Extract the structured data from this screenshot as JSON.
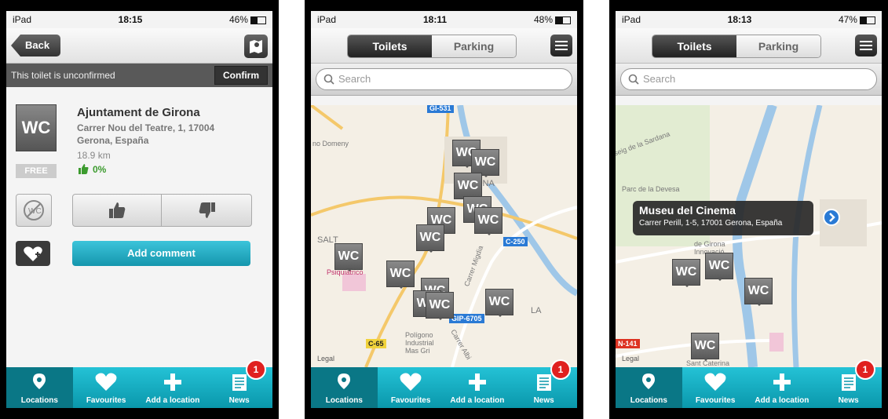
{
  "status": {
    "device": "iPad",
    "screens": [
      {
        "time": "18:15",
        "battery": "46%"
      },
      {
        "time": "18:11",
        "battery": "48%"
      },
      {
        "time": "18:13",
        "battery": "47%"
      }
    ]
  },
  "detail": {
    "back_label": "Back",
    "banner_text": "This toilet is unconfirmed",
    "confirm_label": "Confirm",
    "wc_label": "WC",
    "free_label": "FREE",
    "name": "Ajuntament de Girona",
    "address_line1": "Carrer Nou del Teatre, 1, 17004",
    "address_line2": "Gerona, España",
    "distance": "18.9 km",
    "rating": "0%",
    "add_comment_label": "Add comment"
  },
  "segment": {
    "toilets": "Toilets",
    "parking": "Parking"
  },
  "search": {
    "placeholder": "Search"
  },
  "tabs": [
    {
      "label": "Locations",
      "icon": "pin-icon"
    },
    {
      "label": "Favourites",
      "icon": "heart-icon"
    },
    {
      "label": "Add a location",
      "icon": "plus-icon"
    },
    {
      "label": "News",
      "icon": "news-icon"
    }
  ],
  "news_badge": "1",
  "pin_label": "WC",
  "map1": {
    "roads": [
      "GI-531",
      "C-250",
      "GIP-6705",
      "C-65"
    ],
    "labels": [
      "no Domeny",
      "SALT",
      "Psiquiatrico",
      "ONA",
      "Carrer Migdia",
      "Polígono Industrial Mas Gri",
      "Carrer Albi",
      "LA",
      "Legal"
    ]
  },
  "map2": {
    "labels": [
      "Parc de la Devesa",
      "seig de la Sardana",
      "de Girona Innovació",
      "Legal",
      "Sant Caterina",
      "N-141"
    ],
    "callout_title": "Museu del Cinema",
    "callout_sub": "Carrer Perill, 1-5, 17001 Gerona, España"
  }
}
